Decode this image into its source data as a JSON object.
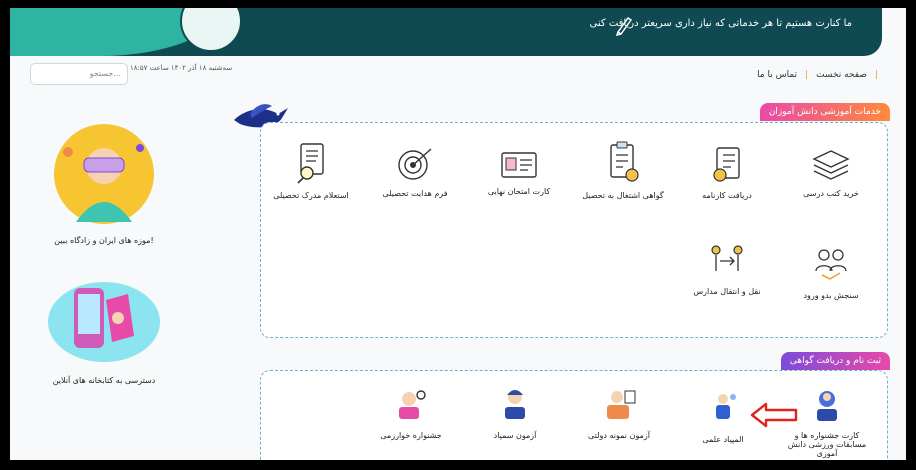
{
  "header": {
    "banner_text": "ما کنارت هستیم تا هر خدماتی که نیاز داری سریعتر دریافت کنی"
  },
  "search": {
    "placeholder": "جستجو..."
  },
  "datetime": "سه‌شنبه ۱۸ آذر ۱۴۰۲ ساعت ۱۸:۵۷",
  "breadcrumb": {
    "home": "صفحه نخست",
    "contact": "تماس با ما"
  },
  "sections": {
    "student_services": {
      "title": "خدمات آموزشی دانش آموزان"
    },
    "registration": {
      "title": "ثبت نام و دریافت گواهی"
    }
  },
  "services": [
    {
      "label": "خرید کتب درسی",
      "icon": "books-icon"
    },
    {
      "label": "دریافت کارنامه",
      "icon": "report-card-icon"
    },
    {
      "label": "گواهی اشتغال به تحصیل",
      "icon": "certificate-icon"
    },
    {
      "label": "کارت امتحان نهایی",
      "icon": "id-card-icon"
    },
    {
      "label": "فرم هدایت تحصیلی",
      "icon": "target-icon"
    },
    {
      "label": "استعلام مدرک تحصیلی",
      "icon": "document-search-icon"
    },
    {
      "label": "سنجش بدو ورود",
      "icon": "assessment-icon"
    },
    {
      "label": "نقل و انتقال مدارس",
      "icon": "transfer-icon"
    }
  ],
  "registration_items": [
    {
      "label": "کارت جشنواره ها و مسابقات ورزشی دانش آموزی",
      "icon": "sports-card-icon"
    },
    {
      "label": "المپیاد علمی",
      "icon": "olympiad-icon"
    },
    {
      "label": "آزمون نمونه دولتی",
      "icon": "exam-icon"
    },
    {
      "label": "آزمون سمپاد",
      "icon": "sampad-icon"
    },
    {
      "label": "جشنواره خوارزمی",
      "icon": "kharazmi-icon"
    }
  ],
  "side_cards": [
    {
      "label": "موزه های ایران و زادگاه ببین!",
      "icon": "vr-person-icon"
    },
    {
      "label": "دسترسی به کتابخانه های آنلاین",
      "icon": "online-library-icon"
    }
  ],
  "colors": {
    "header": "#0f4a52",
    "accent_teal": "#2fb3a3",
    "section_pink": "#e84aa8",
    "section_orange": "#ff8a3c",
    "section_purple": "#7d4adb",
    "arrow_red": "#e0231b"
  }
}
